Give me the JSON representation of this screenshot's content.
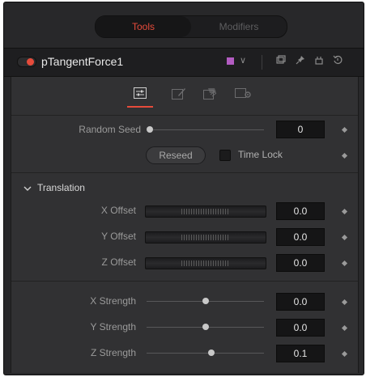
{
  "top_tabs": [
    {
      "label": "Tools",
      "active": true
    },
    {
      "label": "Modifiers",
      "active": false
    }
  ],
  "tool": {
    "name": "pTangentForce1",
    "enabled": true,
    "color": "#b35cc2",
    "header_icons": [
      "copy-icon",
      "pin-icon",
      "lock-icon",
      "reset-icon"
    ]
  },
  "panel_tabs": [
    {
      "icon": "controls-icon",
      "active": true
    },
    {
      "icon": "style-icon",
      "active": false
    },
    {
      "icon": "region-icon",
      "active": false
    },
    {
      "icon": "settings-icon",
      "active": false
    }
  ],
  "random_seed": {
    "label": "Random Seed",
    "value": "0"
  },
  "reseed_label": "Reseed",
  "time_lock": {
    "label": "Time Lock",
    "checked": false
  },
  "translation": {
    "title": "Translation",
    "x_offset": {
      "label": "X Offset",
      "value": "0.0"
    },
    "y_offset": {
      "label": "Y Offset",
      "value": "0.0"
    },
    "z_offset": {
      "label": "Z Offset",
      "value": "0.0"
    }
  },
  "strength": {
    "x": {
      "label": "X Strength",
      "value": "0.0"
    },
    "y": {
      "label": "Y Strength",
      "value": "0.0"
    },
    "z": {
      "label": "Z Strength",
      "value": "0.1"
    }
  },
  "colors": {
    "accent": "#e64b3b",
    "panel": "#313133",
    "background": "#28282a"
  }
}
